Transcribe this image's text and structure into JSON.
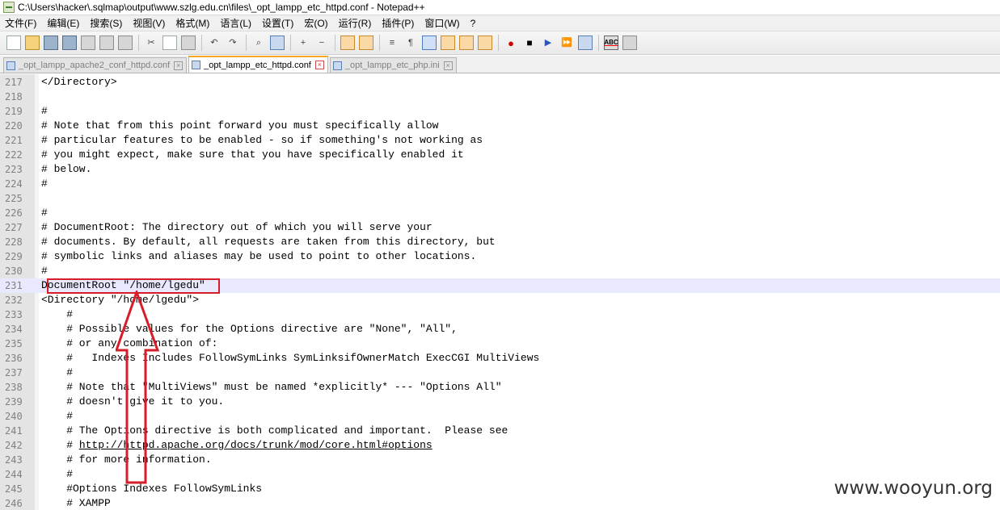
{
  "window": {
    "title": "C:\\Users\\hacker\\.sqlmap\\output\\www.szlg.edu.cn\\files\\_opt_lampp_etc_httpd.conf - Notepad++"
  },
  "menu": [
    "文件(F)",
    "编辑(E)",
    "搜索(S)",
    "视图(V)",
    "格式(M)",
    "语言(L)",
    "设置(T)",
    "宏(O)",
    "运行(R)",
    "插件(P)",
    "窗口(W)",
    "?"
  ],
  "toolbar_icons": [
    "new-file-icon",
    "open-file-icon",
    "save-icon",
    "save-all-icon",
    "close-icon",
    "close-all-icon",
    "print-icon",
    "cut-icon",
    "copy-icon",
    "paste-icon",
    "undo-icon",
    "redo-icon",
    "find-icon",
    "replace-icon",
    "zoom-in-icon",
    "zoom-out-icon",
    "sync-vertical-icon",
    "sync-horizontal-icon",
    "word-wrap-icon",
    "show-all-chars-icon",
    "indent-guide-icon",
    "document-map-icon",
    "function-list-icon",
    "folder-workspace-icon",
    "record-macro-icon",
    "stop-recording-icon",
    "play-macro-icon",
    "run-macro-multiple-icon",
    "save-macro-icon",
    "spell-check-icon",
    "compare-icon"
  ],
  "tabs": [
    {
      "label": "_opt_lampp_apache2_conf_httpd.conf",
      "active": false
    },
    {
      "label": "_opt_lampp_etc_httpd.conf",
      "active": true
    },
    {
      "label": "_opt_lampp_etc_php.ini",
      "active": false
    }
  ],
  "editor": {
    "current_line": 231,
    "lines": [
      {
        "n": "217",
        "text": "</Directory>"
      },
      {
        "n": "218",
        "text": ""
      },
      {
        "n": "219",
        "text": "#"
      },
      {
        "n": "220",
        "text": "# Note that from this point forward you must specifically allow"
      },
      {
        "n": "221",
        "text": "# particular features to be enabled - so if something's not working as"
      },
      {
        "n": "222",
        "text": "# you might expect, make sure that you have specifically enabled it"
      },
      {
        "n": "223",
        "text": "# below."
      },
      {
        "n": "224",
        "text": "#"
      },
      {
        "n": "225",
        "text": ""
      },
      {
        "n": "226",
        "text": "#"
      },
      {
        "n": "227",
        "text": "# DocumentRoot: The directory out of which you will serve your"
      },
      {
        "n": "228",
        "text": "# documents. By default, all requests are taken from this directory, but"
      },
      {
        "n": "229",
        "text": "# symbolic links and aliases may be used to point to other locations."
      },
      {
        "n": "230",
        "text": "#"
      },
      {
        "n": "231",
        "text": "DocumentRoot \"/home/lgedu\""
      },
      {
        "n": "232",
        "text": "<Directory \"/home/lgedu\">"
      },
      {
        "n": "233",
        "text": "    #"
      },
      {
        "n": "234",
        "text": "    # Possible values for the Options directive are \"None\", \"All\","
      },
      {
        "n": "235",
        "text": "    # or any combination of:"
      },
      {
        "n": "236",
        "text": "    #   Indexes Includes FollowSymLinks SymLinksifOwnerMatch ExecCGI MultiViews"
      },
      {
        "n": "237",
        "text": "    #"
      },
      {
        "n": "238",
        "text": "    # Note that \"MultiViews\" must be named *explicitly* --- \"Options All\""
      },
      {
        "n": "239",
        "text": "    # doesn't give it to you."
      },
      {
        "n": "240",
        "text": "    #"
      },
      {
        "n": "241",
        "text": "    # The Options directive is both complicated and important.  Please see"
      },
      {
        "n": "242",
        "prefix": "    # ",
        "link": "http://httpd.apache.org/docs/trunk/mod/core.html#options"
      },
      {
        "n": "243",
        "text": "    # for more information."
      },
      {
        "n": "244",
        "text": "    #"
      },
      {
        "n": "245",
        "text": "    #Options Indexes FollowSymLinks"
      },
      {
        "n": "246",
        "text": "    # XAMPP"
      }
    ]
  },
  "annotation": {
    "color": "#d71d2a"
  },
  "watermark": "www.wooyun.org"
}
